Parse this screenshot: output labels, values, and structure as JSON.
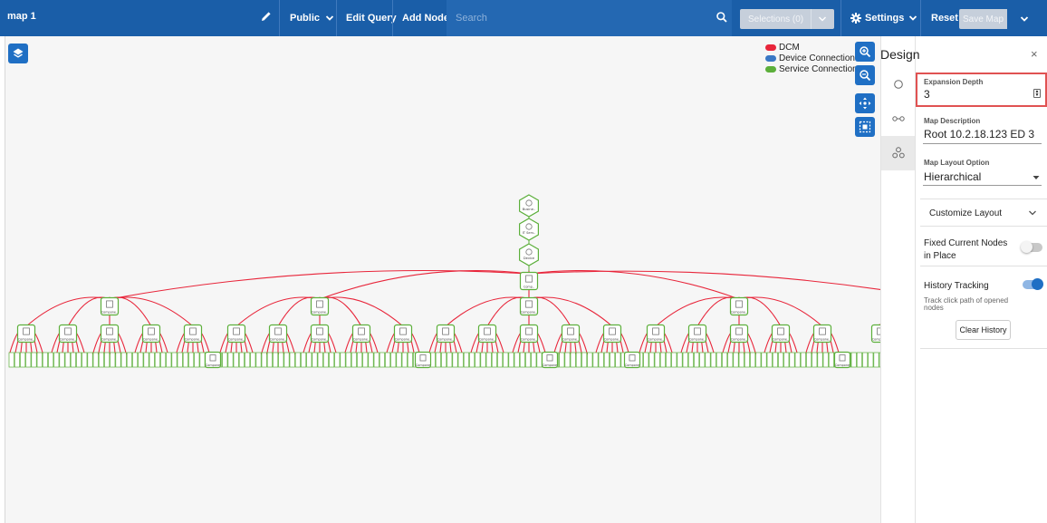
{
  "topbar": {
    "map_title": "map 1",
    "public_label": "Public",
    "edit_query_label": "Edit Query",
    "add_node_label": "Add Node",
    "search_placeholder": "Search",
    "selections_label": "Selections (0)",
    "settings_label": "Settings",
    "reset_label": "Reset",
    "save_map_label": "Save Map",
    "accent": "#1a5ea8"
  },
  "legend": [
    {
      "label": "DCM",
      "color": "#e8253a"
    },
    {
      "label": "Device Connection",
      "color": "#3a78c5"
    },
    {
      "label": "Service Connection",
      "color": "#5caf3b"
    }
  ],
  "graph": {
    "chain_labels": [
      "Busine..",
      "IT Serv..",
      "Device",
      "Comp.."
    ],
    "level1_label": "Compone..",
    "level2_label": "Compone..",
    "leaf_label": "Compone"
  },
  "panel": {
    "title": "Design",
    "close": "×",
    "expansion_depth_label": "Expansion Depth",
    "expansion_depth_value": "3",
    "map_description_label": "Map Description",
    "map_description_value": "Root 10.2.18.123 ED 3",
    "map_layout_label": "Map Layout Option",
    "map_layout_value": "Hierarchical",
    "customize_layout_label": "Customize Layout",
    "fixed_nodes_label": "Fixed Current Nodes in Place",
    "fixed_nodes_on": false,
    "history_tracking_label": "History Tracking",
    "history_tracking_on": true,
    "history_hint": "Track click path of opened nodes",
    "clear_history_label": "Clear History",
    "toggle_on_color": "#1f6fc4",
    "highlight_color": "#e05252"
  },
  "icons": {
    "edit": "pencil-icon",
    "search": "search-icon",
    "settings": "gear-icon",
    "layers": "layers-icon",
    "zoom_in": "zoom-in-icon",
    "zoom_out": "zoom-out-icon",
    "move": "move-icon",
    "fit": "fit-screen-icon",
    "node": "node-icon",
    "link": "link-icon",
    "cluster": "cluster-icon"
  }
}
